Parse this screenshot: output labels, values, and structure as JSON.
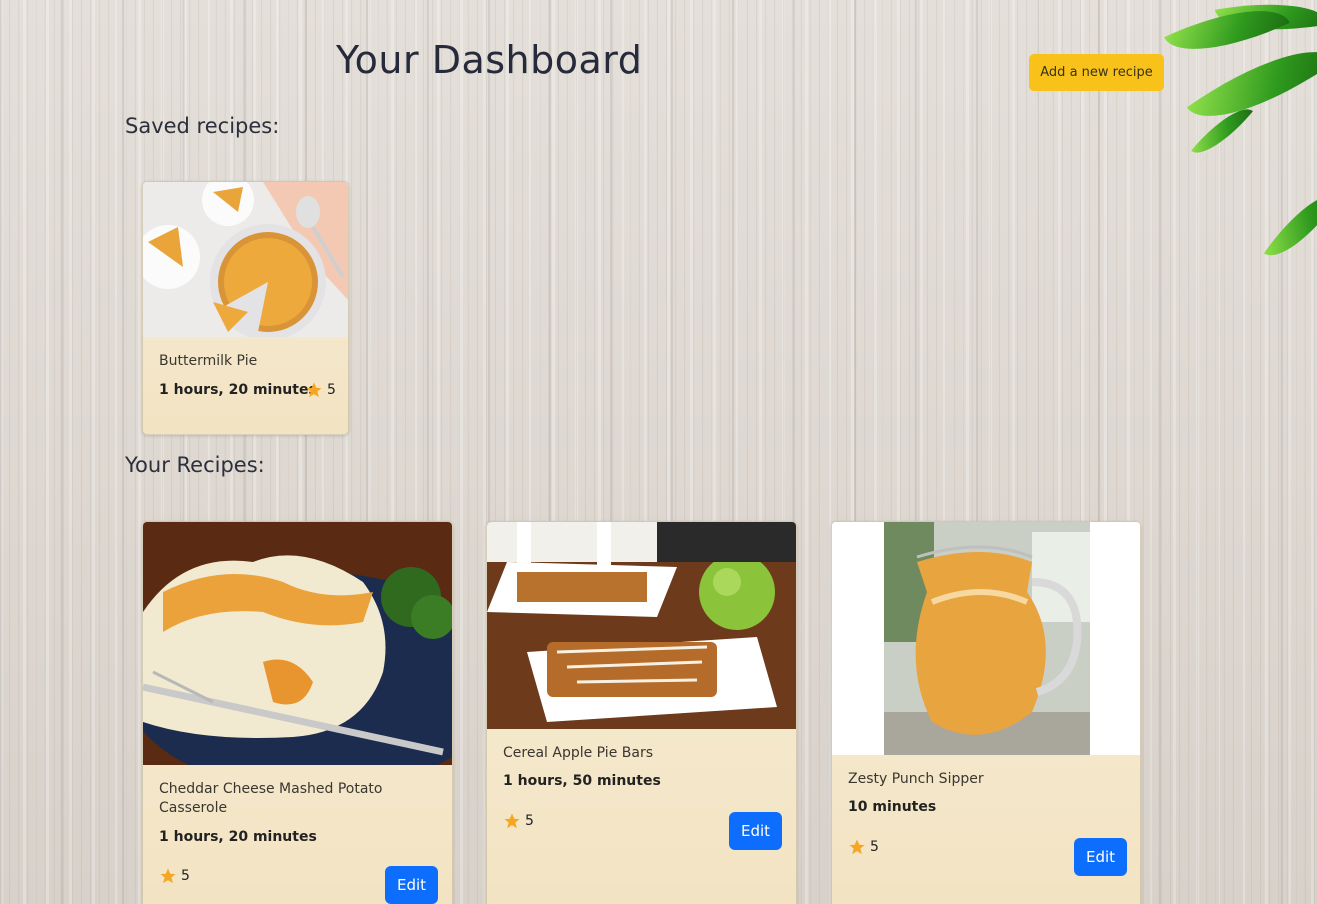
{
  "header": {
    "title": "Your Dashboard",
    "add_button_label": "Add a new recipe"
  },
  "saved_section": {
    "heading": "Saved recipes:",
    "cards": [
      {
        "name": "Buttermilk Pie",
        "time": "1 hours, 20 minutes",
        "rating": "5",
        "image": "buttermilk-pie-photo"
      }
    ]
  },
  "your_section": {
    "heading": "Your Recipes:",
    "cards": [
      {
        "name": "Cheddar Cheese Mashed Potato Casserole",
        "time": "1 hours, 20 minutes",
        "rating": "5",
        "edit_label": "Edit",
        "image": "mashed-potato-casserole-photo"
      },
      {
        "name": "Cereal Apple Pie Bars",
        "time": "1 hours, 50 minutes",
        "rating": "5",
        "edit_label": "Edit",
        "image": "apple-pie-bars-photo"
      },
      {
        "name": "Zesty Punch Sipper",
        "time": "10 minutes",
        "rating": "5",
        "edit_label": "Edit",
        "image": "punch-pitcher-photo"
      }
    ]
  },
  "colors": {
    "accent_button": "#f8c21a",
    "edit_button": "#0d6efd",
    "star": "#f5a623",
    "card_background": "#f5e8cc"
  }
}
